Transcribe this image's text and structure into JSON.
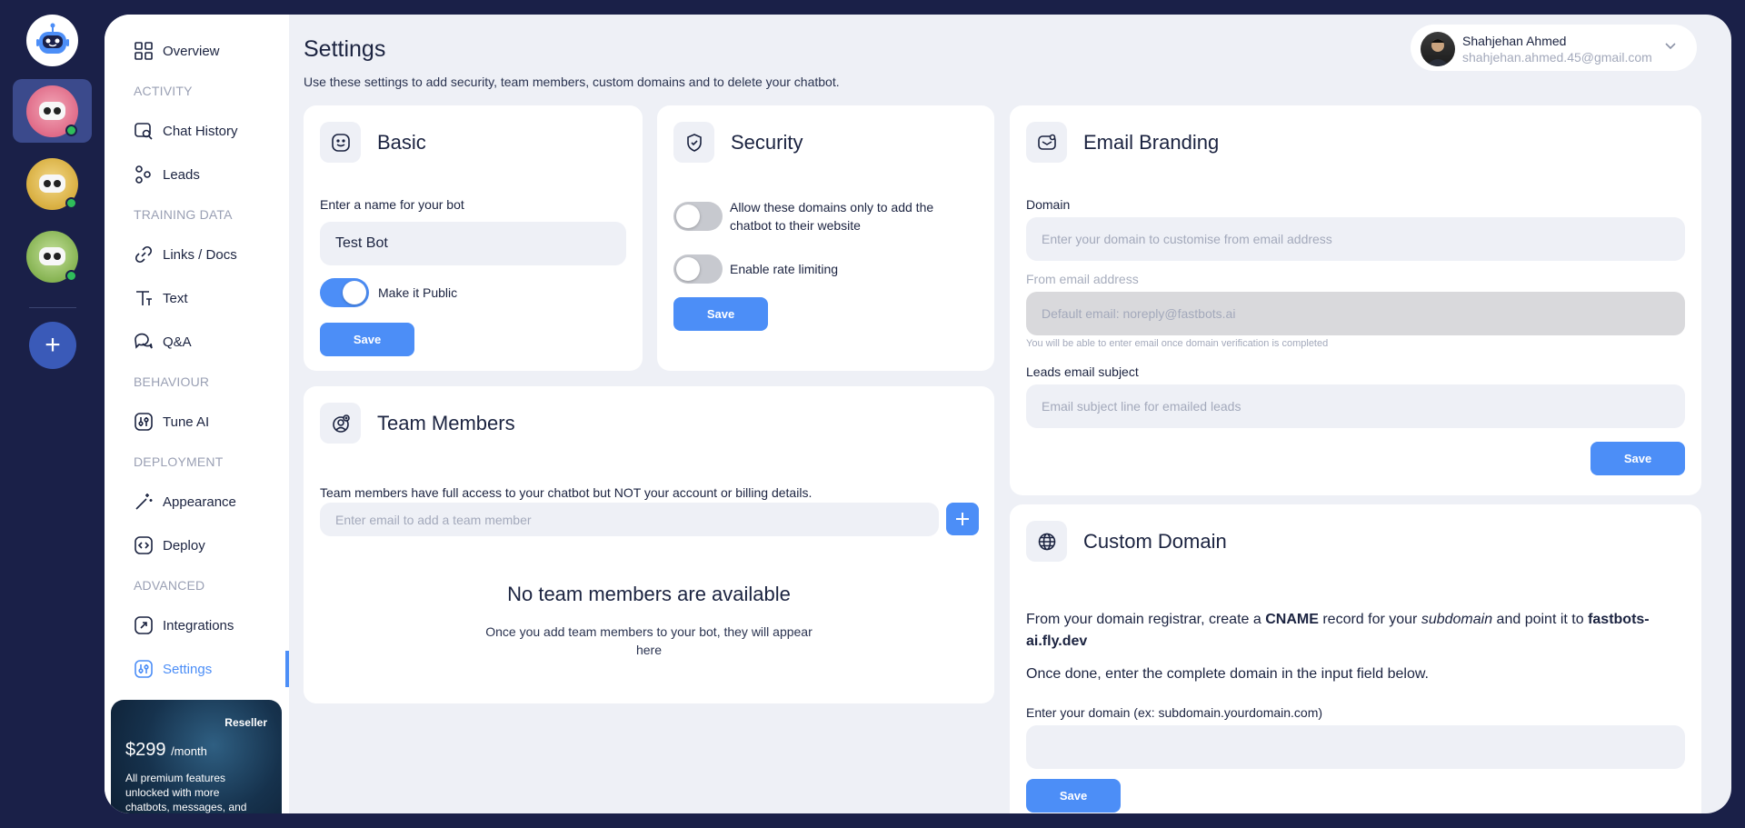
{
  "rail": {
    "bots": [
      {
        "name": "bot-pink",
        "color": "#e98aa0"
      },
      {
        "name": "bot-yellow",
        "color": "#e6c15a"
      },
      {
        "name": "bot-green",
        "color": "#9bc46a"
      }
    ],
    "add_label": "+"
  },
  "sidebar": {
    "overview": "Overview",
    "section_activity": "ACTIVITY",
    "chat_history": "Chat History",
    "leads": "Leads",
    "section_training": "TRAINING DATA",
    "links_docs": "Links / Docs",
    "text": "Text",
    "qa": "Q&A",
    "section_behaviour": "BEHAVIOUR",
    "tune_ai": "Tune AI",
    "section_deployment": "DEPLOYMENT",
    "appearance": "Appearance",
    "deploy": "Deploy",
    "section_advanced": "ADVANCED",
    "integrations": "Integrations",
    "settings": "Settings"
  },
  "promo": {
    "tag": "Reseller",
    "price": "$299",
    "period": "/month",
    "desc": "All premium features unlocked with more chatbots, messages, and"
  },
  "header": {
    "title": "Settings",
    "subtitle": "Use these settings to add security, team members, custom domains and to delete your chatbot."
  },
  "user": {
    "name": "Shahjehan Ahmed",
    "email": "shahjehan.ahmed.45@gmail.com"
  },
  "basic": {
    "title": "Basic",
    "name_label": "Enter a name for your bot",
    "name_value": "Test Bot",
    "public_label": "Make it Public",
    "public_on": true,
    "save": "Save"
  },
  "security": {
    "title": "Security",
    "domains_label": "Allow these domains only to add the chatbot to their website",
    "domains_on": false,
    "rate_label": "Enable rate limiting",
    "rate_on": false,
    "save": "Save"
  },
  "email_branding": {
    "title": "Email Branding",
    "domain_label": "Domain",
    "domain_placeholder": "Enter your domain to customise from email address",
    "from_label": "From email address",
    "from_placeholder": "Default email: noreply@fastbots.ai",
    "from_hint": "You will be able to enter email once domain verification is completed",
    "subject_label": "Leads email subject",
    "subject_placeholder": "Email subject line for emailed leads",
    "save": "Save"
  },
  "team": {
    "title": "Team Members",
    "desc": "Team members have full access to your chatbot but NOT your account or billing details.",
    "email_placeholder": "Enter email to add a team member",
    "empty_title": "No team members are available",
    "empty_sub": "Once you add team members to your bot, they will appear here"
  },
  "custom_domain": {
    "title": "Custom Domain",
    "p1_a": "From your domain registrar, create a ",
    "p1_b": "CNAME",
    "p1_c": " record for your ",
    "p1_d": "subdomain",
    "p1_e": " and point it to ",
    "p1_f": "fastbots-ai.fly.dev",
    "p2": "Once done, enter the complete domain in the input field below.",
    "input_label": "Enter your domain (ex: subdomain.yourdomain.com)",
    "input_value": "",
    "save": "Save"
  },
  "colors": {
    "accent": "#4c8ef7",
    "background": "#1a2048",
    "online": "#2fbd5a"
  }
}
